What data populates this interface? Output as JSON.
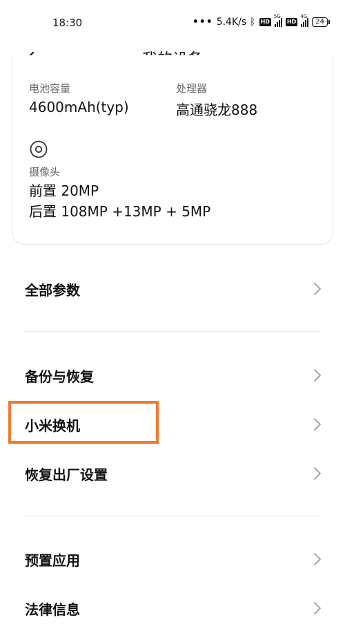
{
  "status_bar": {
    "time": "18:30",
    "dots": "•••",
    "net_speed": "5.4K/s",
    "bluetooth_icon": "bluetooth-icon",
    "hd1": "HD",
    "sig1_tag": "5G",
    "hd2": "HD",
    "sig2_tag": "4G",
    "battery": "24"
  },
  "header": {
    "title": "我的设备",
    "back_icon": "arrow-left-icon"
  },
  "specs": {
    "battery_label": "电池容量",
    "battery_value": "4600mAh(typ)",
    "cpu_label": "处理器",
    "cpu_value": "高通骁龙888",
    "camera_icon": "camera-icon",
    "camera_label": "摄像头",
    "front_camera": "前置 20MP",
    "rear_camera": "后置 108MP +13MP + 5MP"
  },
  "menu": {
    "all_params": "全部参数",
    "backup_restore": "备份与恢复",
    "mi_mover": "小米换机",
    "factory_reset": "恢复出厂设置",
    "preinstalled_apps": "预置应用",
    "legal_info": "法律信息"
  },
  "colors": {
    "highlight": "#f07a2e",
    "divider": "#e8e8e8",
    "chevron": "#9a9a9a"
  }
}
